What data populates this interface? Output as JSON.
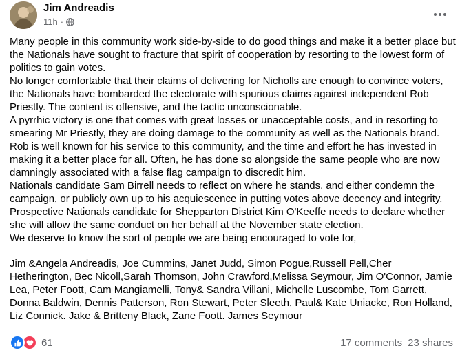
{
  "post": {
    "author": "Jim Andreadis",
    "time": "11h",
    "time_separator": "·",
    "paragraphs": [
      "Many people in this community work side-by-side to do good things and make it a better place but the Nationals have sought to fracture that spirit of cooperation by resorting to the lowest form of politics to gain votes.",
      "No longer comfortable that their claims of delivering for Nicholls are enough to convince voters, the Nationals have bombarded the electorate with spurious claims against independent Rob Priestly. The content is offensive, and the tactic unconscionable.",
      "A pyrrhic victory is one that comes with great losses or unacceptable costs, and in resorting to smearing Mr Priestly, they are doing damage to the community as well as the Nationals brand.",
      "Rob is well known for his service to this community, and the time and effort he has invested in making it a better place for all. Often, he has done so alongside the same people who are now damningly associated with a false flag campaign to discredit him.",
      "Nationals candidate Sam Birrell needs to reflect on where he stands, and either condemn the campaign, or publicly own up to his acquiescence in putting votes above decency and integrity.",
      "Prospective Nationals candidate for Shepparton District Kim O'Keeffe needs to declare whether she will allow the same conduct on her behalf at the November state election.",
      "We deserve to know the sort of people we are being encouraged to vote for,"
    ],
    "signatories": "Jim &Angela Andreadis, Joe Cummins, Janet Judd, Simon Pogue,Russell Pell,Cher Hetherington, Bec Nicoll,Sarah Thomson, John Crawford,Melissa Seymour, Jim O'Connor, Jamie Lea, Peter Foott, Cam Mangiamelli, Tony& Sandra Villani, Michelle Luscombe, Tom Garrett, Donna Baldwin, Dennis Patterson, Ron Stewart, Peter Sleeth, Paul& Kate Uniacke, Ron Holland, Liz Connick. Jake & Britteny Black, Zane Foott. James Seymour"
  },
  "footer": {
    "reaction_count": "61",
    "comments": "17 comments",
    "shares": "23 shares"
  },
  "icons": {
    "like": "like-icon",
    "love": "love-icon",
    "globe": "globe-icon",
    "more": "more-options-icon"
  },
  "colors": {
    "like": "#1877f2",
    "love": "#f33e58",
    "secondary_text": "#65676b"
  }
}
